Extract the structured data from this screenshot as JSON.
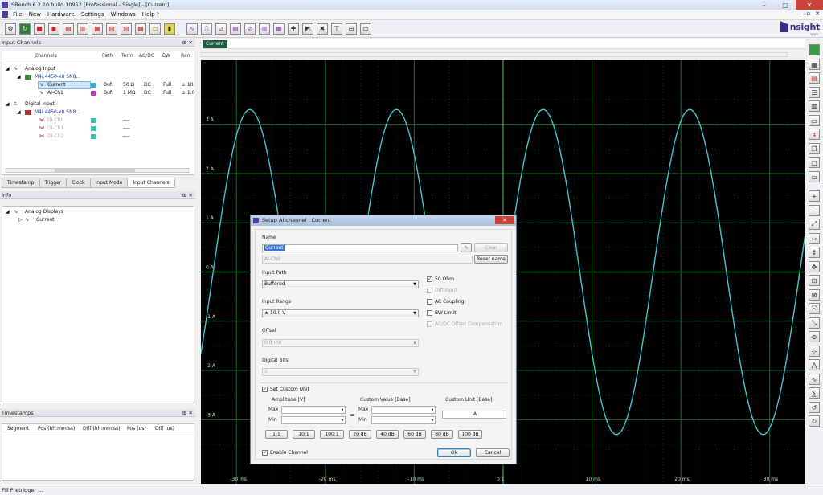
{
  "window": {
    "title": "SBench 6.2.10 build 10952 [Professional - Single] - [Current]"
  },
  "menu": [
    "File",
    "New",
    "Hardware",
    "Settings",
    "Windows",
    "Help"
  ],
  "logo": {
    "text": "nsight",
    "sub": "ware"
  },
  "panels": {
    "input_channels": {
      "title": "Input Channels",
      "columns": [
        "Channels",
        "Path",
        "Term",
        "AC/DC",
        "BW",
        "Ran"
      ],
      "tree": {
        "analog_group": "Analog Input",
        "analog_card": "M4i.4450-x8 SN8...",
        "channels": [
          {
            "name": "Current",
            "path": "Buf.",
            "term": "50 Ω",
            "acdc": "DC",
            "bw": "Full",
            "range": "± 10.",
            "color": "#2fb8d8"
          },
          {
            "name": "AI-Ch1",
            "path": "Buf.",
            "term": "1 MΩ",
            "acdc": "DC",
            "bw": "Full",
            "range": "± 1.0",
            "color": "#c43ad0"
          }
        ],
        "digital_group": "Digital Input",
        "digital_card": "M4i.4450-x8 SN8...",
        "digital_channels": [
          {
            "name": "DI-Ch0",
            "value": "----",
            "color": "#2fc8b0"
          },
          {
            "name": "DI-Ch1",
            "value": "----",
            "color": "#2fc8b0"
          },
          {
            "name": "DI-Ch2",
            "value": "----",
            "color": "#2fc8b0"
          }
        ]
      },
      "tabs": [
        "Timestamp",
        "Trigger",
        "Clock",
        "Input Mode",
        "Input Channels"
      ]
    },
    "info": {
      "title": "Info",
      "group": "Analog Displays",
      "item": "Current"
    },
    "timestamps": {
      "title": "Timestamps",
      "columns": [
        "Segment",
        "Pos (hh:mm:ss)",
        "Diff (hh:mm:ss)",
        "Pos (us)",
        "Diff (us)"
      ]
    }
  },
  "status": "Fill Pretrigger ...",
  "display": {
    "tab": "Current",
    "y_ticks": [
      "3 A",
      "2 A",
      "1 A",
      "0 A",
      "-1 A",
      "-2 A",
      "-3 A"
    ],
    "x_ticks": [
      "-30 ms",
      "-20 ms",
      "-10 ms",
      "0 s",
      "10 ms",
      "20 ms",
      "30 ms"
    ],
    "trace_color": "#3fc6d2",
    "grid_color": "#1d6a2a"
  },
  "chart_data": {
    "type": "line",
    "series": [
      {
        "name": "Current",
        "form": "sine",
        "amplitude": 3.3,
        "period_ms": 16.5,
        "peak_at_ms": -28.5
      }
    ],
    "xlim": [
      -34,
      34
    ],
    "ylim": [
      -4.3,
      4.3
    ],
    "xlabel": "",
    "ylabel": "",
    "grid": true
  },
  "dialog": {
    "title": "Setup AI channel : Current",
    "name_label": "Name",
    "name_value": "Current",
    "clear_label": "Clear",
    "default_name": "AI-Ch0",
    "reset_label": "Reset name",
    "input_path_label": "Input Path",
    "input_path_value": "Buffered",
    "input_range_label": "Input Range",
    "input_range_value": "± 10.0 V",
    "offset_label": "Offset",
    "offset_value": "0.0 mV",
    "digital_bits_label": "Digital Bits",
    "digital_bits_value": "0",
    "checks": {
      "ohm50": "50 Ohm",
      "diff_input": "Diff Input",
      "ac_coupling": "AC Coupling",
      "bw_limit": "BW Limit",
      "acdc_comp": "AC/DC Offset Compensation"
    },
    "custom_unit_label": "Set Custom Unit",
    "amplitude_label": "Amplitude [V]",
    "custom_value_label": "Custom Value [Base]",
    "custom_unit_base_label": "Custom Unit [Base]",
    "max_label": "Max",
    "min_label": "Min",
    "equals": "=",
    "unit_value": "A",
    "ratio_buttons": [
      "1:1",
      "10:1",
      "100:1",
      "20 dB",
      "40 dB",
      "60 dB",
      "80 dB",
      "100 dB"
    ],
    "enable_label": "Enable Channel",
    "ok_label": "Ok",
    "cancel_label": "Cancel"
  }
}
